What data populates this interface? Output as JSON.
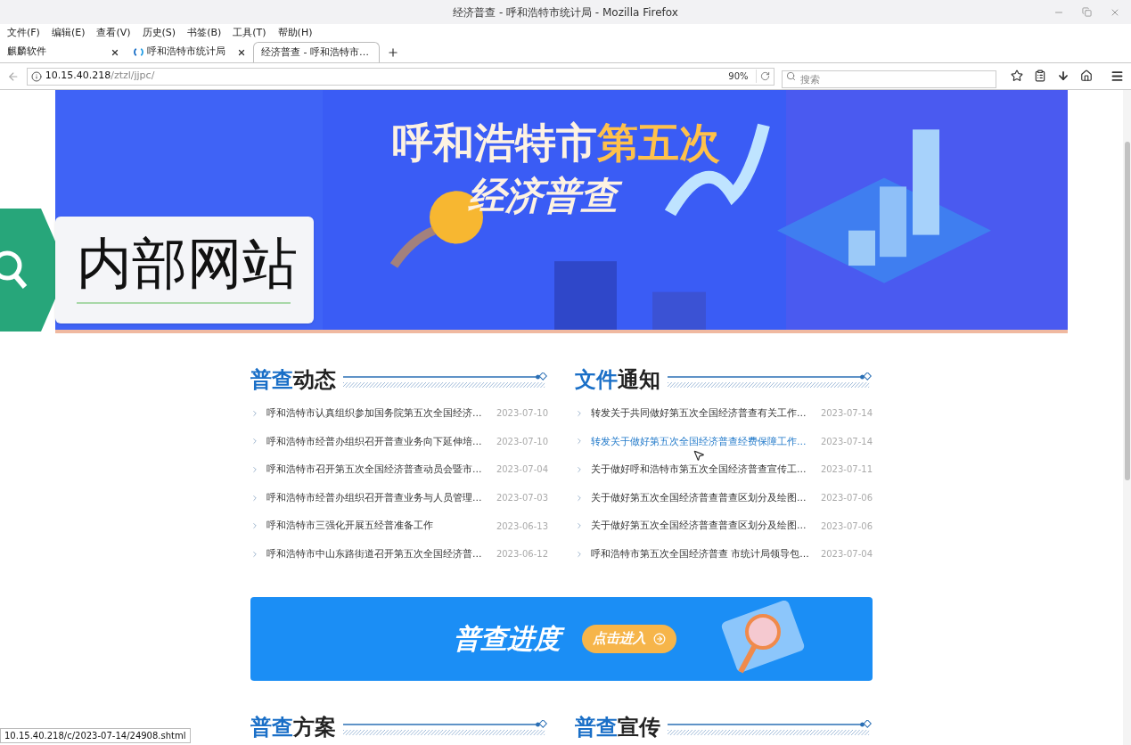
{
  "window": {
    "title": "经济普查 - 呼和浩特市统计局 - Mozilla Firefox"
  },
  "menu": [
    "文件(F)",
    "编辑(E)",
    "查看(V)",
    "历史(S)",
    "书签(B)",
    "工具(T)",
    "帮助(H)"
  ],
  "tabs": [
    {
      "label": "麒麟软件",
      "selected": false,
      "favicon": false
    },
    {
      "label": "呼和浩特市统计局",
      "selected": false,
      "favicon": true
    },
    {
      "label": "经济普查 - 呼和浩特市…",
      "selected": true,
      "favicon": false
    }
  ],
  "address": {
    "host": "10.15.40.218",
    "path": "/ztzl/jjpc/",
    "zoom": "90%"
  },
  "search": {
    "placeholder": "搜索"
  },
  "overlay_badge": {
    "label": "内部网站"
  },
  "banner": {
    "title": "呼和浩特市",
    "title_highlight": "第五次",
    "subtitle": "经济普查"
  },
  "sections": [
    {
      "accent": "普查",
      "rest": "动态",
      "items": [
        {
          "title": "呼和浩特市认真组织参加国务院第五次全国经济…",
          "date": "2023-07-10",
          "hovered": false
        },
        {
          "title": "呼和浩特市经普办组织召开普查业务向下延伸培…",
          "date": "2023-07-10",
          "hovered": false
        },
        {
          "title": "呼和浩特市召开第五次全国经济普查动员会暨市…",
          "date": "2023-07-04",
          "hovered": false
        },
        {
          "title": "呼和浩特市经普办组织召开普查业务与人员管理…",
          "date": "2023-07-03",
          "hovered": false
        },
        {
          "title": "呼和浩特市三强化开展五经普准备工作",
          "date": "2023-06-13",
          "hovered": false
        },
        {
          "title": "呼和浩特市中山东路街道召开第五次全国经济普…",
          "date": "2023-06-12",
          "hovered": false
        }
      ]
    },
    {
      "accent": "文件",
      "rest": "通知",
      "items": [
        {
          "title": "转发关于共同做好第五次全国经济普查有关工作…",
          "date": "2023-07-14",
          "hovered": false
        },
        {
          "title": "转发关于做好第五次全国经济普查经费保障工作…",
          "date": "2023-07-14",
          "hovered": true
        },
        {
          "title": "关于做好呼和浩特市第五次全国经济普查宣传工…",
          "date": "2023-07-11",
          "hovered": false
        },
        {
          "title": "关于做好第五次全国经济普查普查区划分及绘图…",
          "date": "2023-07-06",
          "hovered": false
        },
        {
          "title": "关于做好第五次全国经济普查普查区划分及绘图…",
          "date": "2023-07-06",
          "hovered": false
        },
        {
          "title": "呼和浩特市第五次全国经济普查 市统计局领导包…",
          "date": "2023-07-04",
          "hovered": false
        }
      ]
    }
  ],
  "progress_banner": {
    "title": "普查进度",
    "button": "点击进入"
  },
  "lower_sections": [
    {
      "accent": "普查",
      "rest": "方案"
    },
    {
      "accent": "普查",
      "rest": "宣传"
    }
  ],
  "status_link": "10.15.40.218/c/2023-07-14/24908.shtml"
}
